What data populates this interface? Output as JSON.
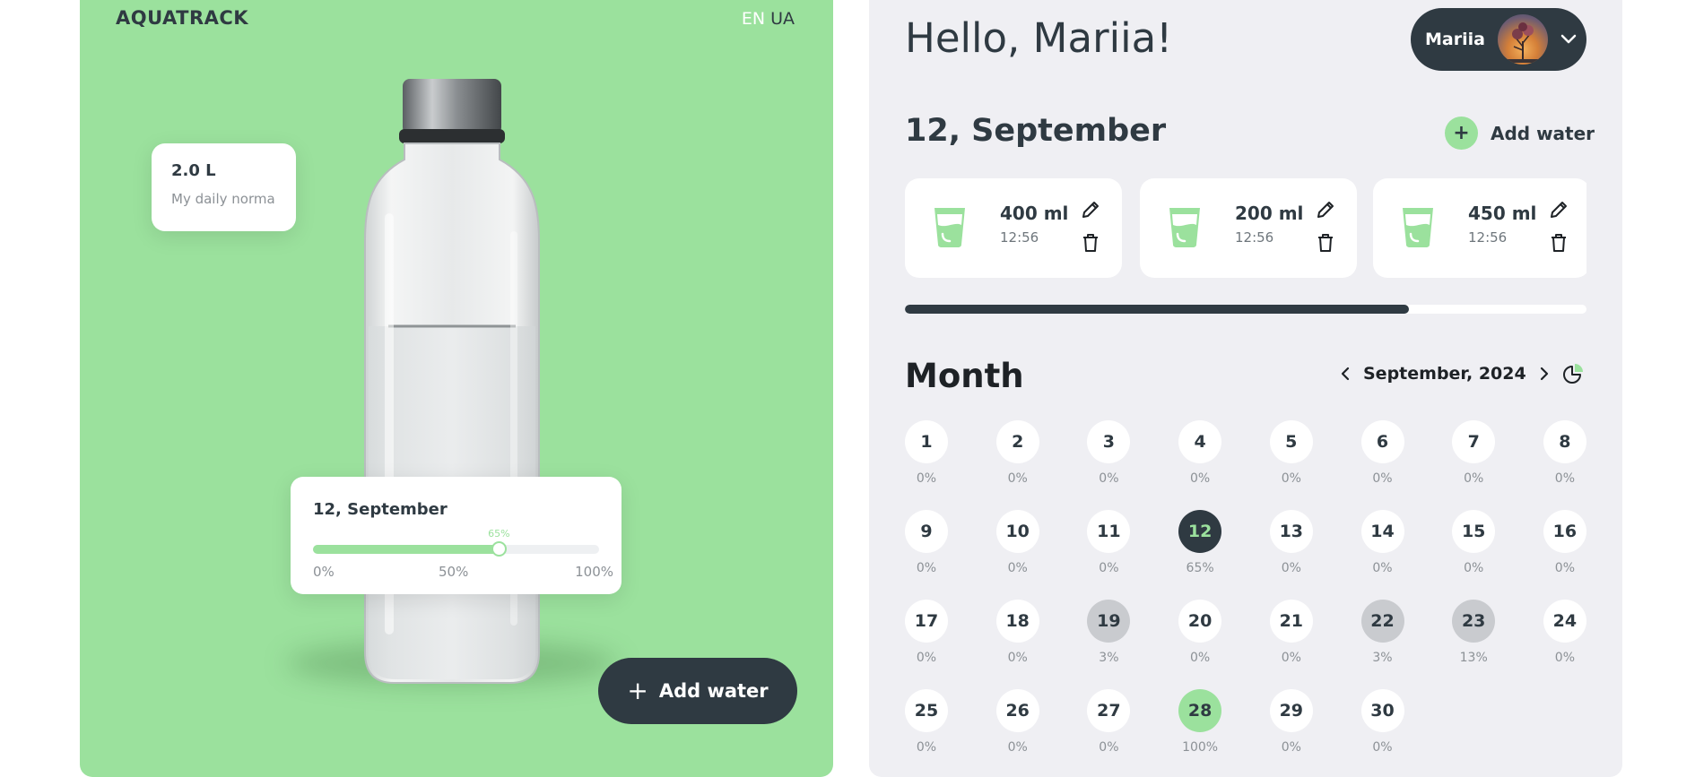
{
  "brand": {
    "logo": "AQUATRACK"
  },
  "language": {
    "options": [
      "EN",
      "UA"
    ],
    "active": "EN"
  },
  "left": {
    "norma": {
      "value": "2.0 L",
      "label": "My daily norma"
    },
    "today_progress": {
      "title": "12, September",
      "percent": 65,
      "percent_label": "65%",
      "ticks": [
        "0%",
        "50%",
        "100%"
      ]
    },
    "add_water_button": "Add water"
  },
  "header": {
    "greeting": "Hello, Mariia!",
    "user_name": "Mariia"
  },
  "day": {
    "title": "12, September",
    "add_water_link": "Add water",
    "entries": [
      {
        "amount": "400 ml",
        "time": "12:56"
      },
      {
        "amount": "200 ml",
        "time": "12:56"
      },
      {
        "amount": "450 ml",
        "time": "12:56"
      }
    ],
    "progress_fraction": 0.74
  },
  "month": {
    "title": "Month",
    "label": "September, 2024",
    "days": [
      {
        "day": "1",
        "pct": "0%"
      },
      {
        "day": "2",
        "pct": "0%"
      },
      {
        "day": "3",
        "pct": "0%"
      },
      {
        "day": "4",
        "pct": "0%"
      },
      {
        "day": "5",
        "pct": "0%"
      },
      {
        "day": "6",
        "pct": "0%"
      },
      {
        "day": "7",
        "pct": "0%"
      },
      {
        "day": "8",
        "pct": "0%"
      },
      {
        "day": "9",
        "pct": "0%"
      },
      {
        "day": "10",
        "pct": "0%"
      },
      {
        "day": "11",
        "pct": "0%"
      },
      {
        "day": "12",
        "pct": "65%",
        "state": "today"
      },
      {
        "day": "13",
        "pct": "0%"
      },
      {
        "day": "14",
        "pct": "0%"
      },
      {
        "day": "15",
        "pct": "0%"
      },
      {
        "day": "16",
        "pct": "0%"
      },
      {
        "day": "17",
        "pct": "0%"
      },
      {
        "day": "18",
        "pct": "0%"
      },
      {
        "day": "19",
        "pct": "3%",
        "state": "partial"
      },
      {
        "day": "20",
        "pct": "0%"
      },
      {
        "day": "21",
        "pct": "0%"
      },
      {
        "day": "22",
        "pct": "3%",
        "state": "partial"
      },
      {
        "day": "23",
        "pct": "13%",
        "state": "partial"
      },
      {
        "day": "24",
        "pct": "0%"
      },
      {
        "day": "25",
        "pct": "0%"
      },
      {
        "day": "26",
        "pct": "0%"
      },
      {
        "day": "27",
        "pct": "0%"
      },
      {
        "day": "28",
        "pct": "100%",
        "state": "full"
      },
      {
        "day": "29",
        "pct": "0%"
      },
      {
        "day": "30",
        "pct": "0%"
      }
    ]
  },
  "colors": {
    "accent": "#9be19d",
    "dark": "#2f3a42",
    "panel": "#efeff3"
  }
}
